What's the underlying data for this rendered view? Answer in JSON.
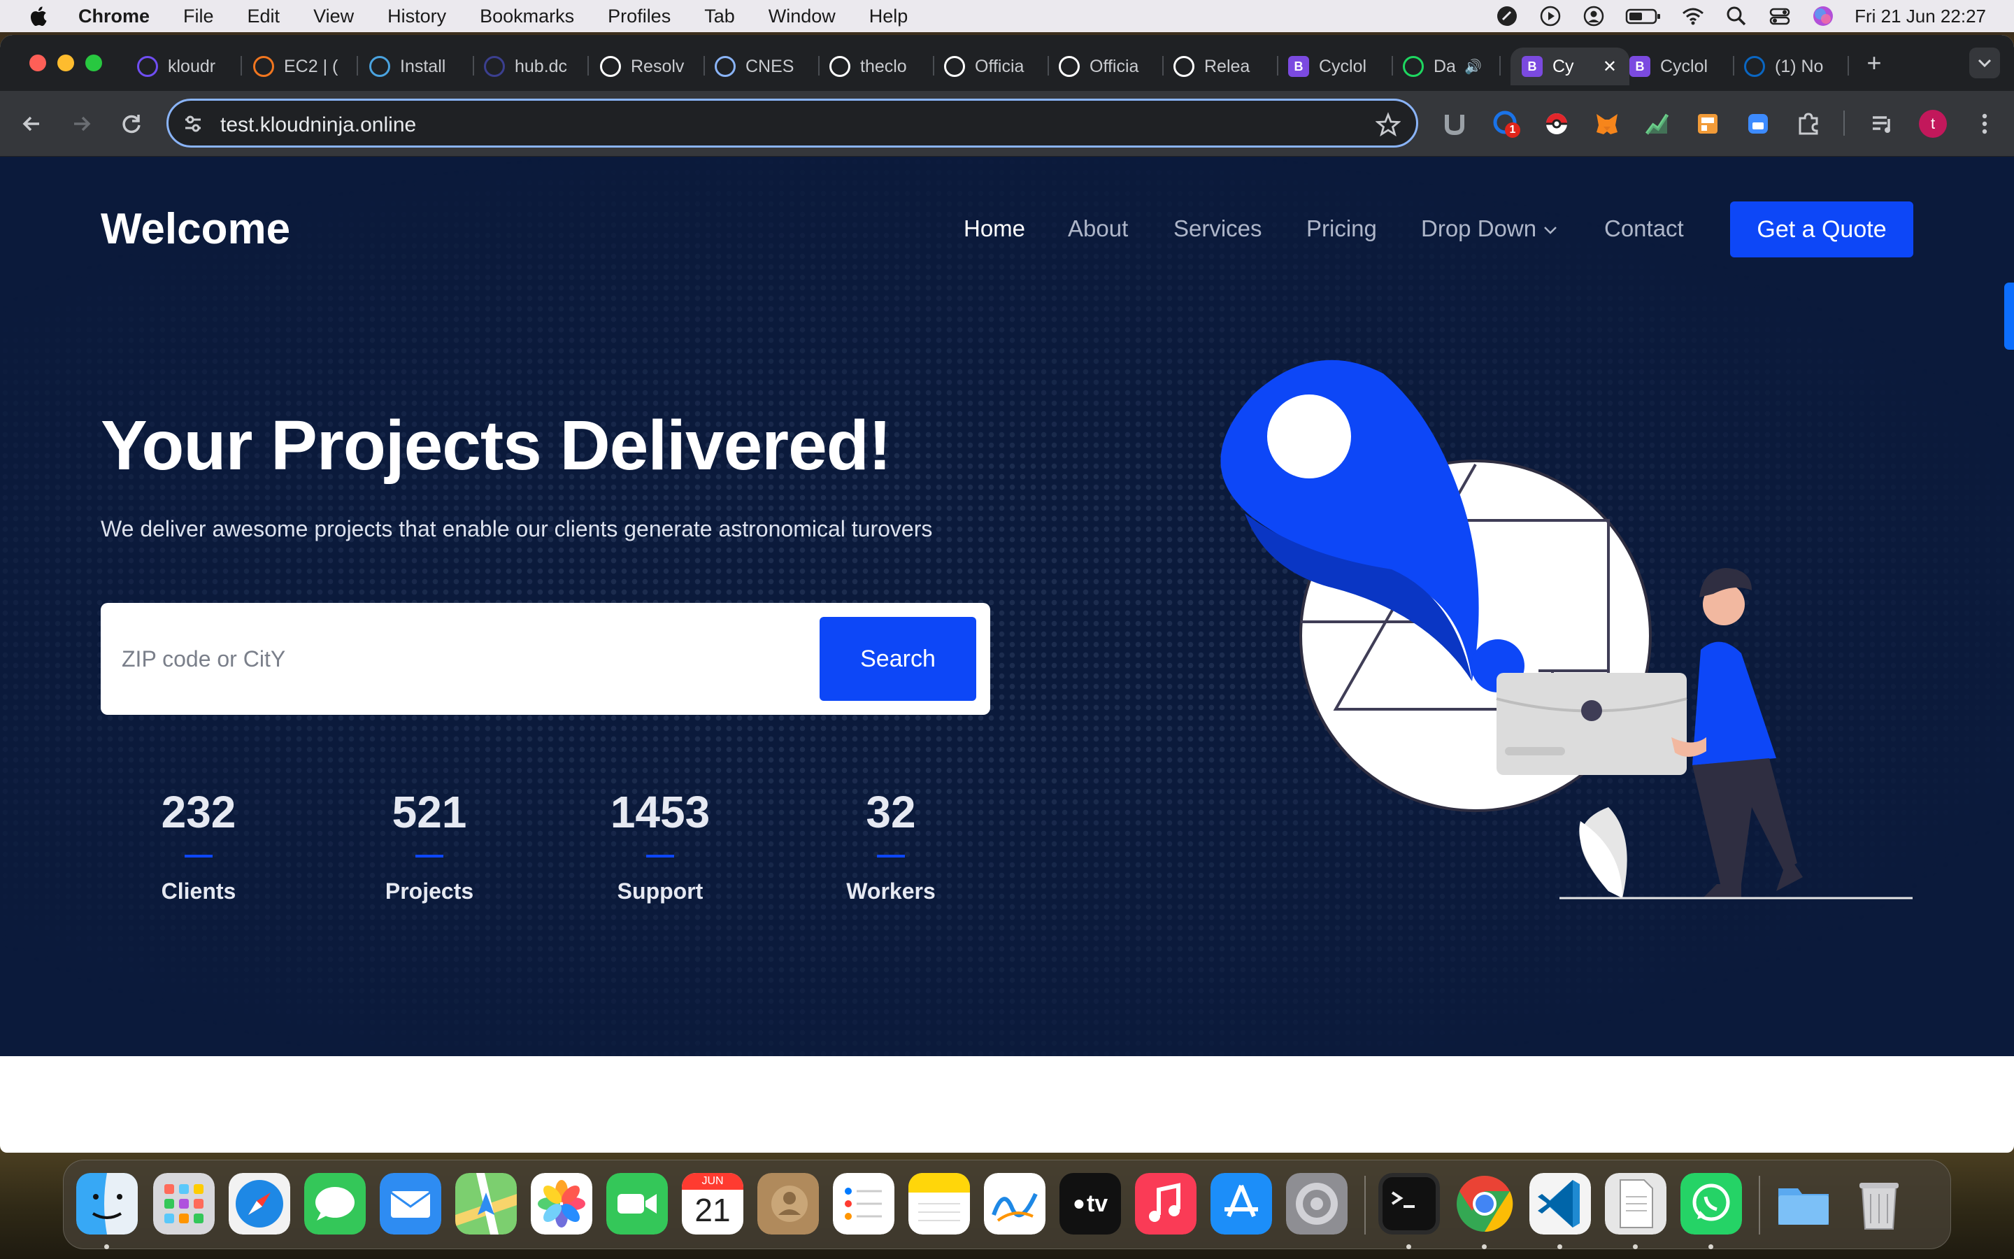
{
  "menubar": {
    "app_name": "Chrome",
    "items": [
      "File",
      "Edit",
      "View",
      "History",
      "Bookmarks",
      "Profiles",
      "Tab",
      "Window",
      "Help"
    ],
    "clock": "Fri 21 Jun  22:27"
  },
  "browser": {
    "tabs": [
      {
        "title": "kloudr",
        "icon": "kloudninja-icon",
        "color": "#6f4ef2"
      },
      {
        "title": "EC2 | (",
        "icon": "aws-ec2-icon",
        "color": "#f1761f"
      },
      {
        "title": "Install",
        "icon": "install-icon",
        "color": "#4aa3df"
      },
      {
        "title": "hub.dc",
        "icon": "docker-hub-icon",
        "color": "#3b3f8f"
      },
      {
        "title": "Resolv",
        "icon": "chatgpt-icon",
        "color": "#ffffff"
      },
      {
        "title": "CNES",
        "icon": "cnes-icon",
        "color": "#8ab4f8"
      },
      {
        "title": "theclo",
        "icon": "github-icon",
        "color": "#ffffff"
      },
      {
        "title": "Officia",
        "icon": "github-icon",
        "color": "#ffffff"
      },
      {
        "title": "Officia",
        "icon": "github-icon",
        "color": "#ffffff"
      },
      {
        "title": "Relea",
        "icon": "github-icon",
        "color": "#ffffff"
      },
      {
        "title": "Cyclol",
        "icon": "bootstrap-icon",
        "color": "#7b4ae0"
      },
      {
        "title": "Da",
        "icon": "spotify-icon",
        "color": "#1ed760"
      },
      {
        "title": "Cy",
        "icon": "bootstrap-icon",
        "color": "#7b4ae0"
      },
      {
        "title": "Cyclol",
        "icon": "bootstrap-icon",
        "color": "#7b4ae0"
      },
      {
        "title": "(1) No",
        "icon": "linkedin-icon",
        "color": "#0a66c2"
      }
    ],
    "bootstrap_letter": "B",
    "url": "test.kloudninja.online",
    "extension_badge": "1",
    "profile_initial": "t"
  },
  "site": {
    "brand": "Welcome",
    "nav": [
      "Home",
      "About",
      "Services",
      "Pricing",
      "Drop Down",
      "Contact"
    ],
    "cta": "Get a Quote",
    "hero_title": "Your Projects Delivered!",
    "hero_subtitle": "We deliver awesome projects that enable our clients generate astronomical turovers",
    "search_placeholder": "ZIP code or CitY",
    "search_button": "Search",
    "stats": [
      {
        "value": "232",
        "label": "Clients"
      },
      {
        "value": "521",
        "label": "Projects"
      },
      {
        "value": "1453",
        "label": "Support"
      },
      {
        "value": "32",
        "label": "Workers"
      }
    ],
    "colors": {
      "background": "#0b1a3b",
      "accent": "#0d47f7"
    }
  },
  "dock": {
    "calendar_month": "JUN",
    "calendar_day": "21",
    "appletv_label": "tv",
    "apps": [
      "Finder",
      "Launchpad",
      "Safari",
      "Messages",
      "Mail",
      "Maps",
      "Photos",
      "FaceTime",
      "Calendar",
      "Contacts",
      "Reminders",
      "Notes",
      "Freeform",
      "TV",
      "Music",
      "App Store",
      "System Settings",
      "Terminal",
      "Chrome",
      "VS Code",
      "TextEdit",
      "WhatsApp",
      "Downloads",
      "Trash"
    ]
  }
}
